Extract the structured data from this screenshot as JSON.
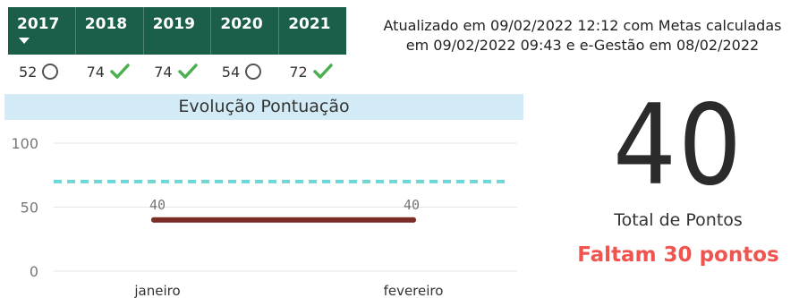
{
  "tabs": [
    "2017",
    "2018",
    "2019",
    "2020",
    "2021"
  ],
  "scores": [
    {
      "value": "52",
      "status": "circle-icon"
    },
    {
      "value": "74",
      "status": "check-icon"
    },
    {
      "value": "74",
      "status": "check-icon"
    },
    {
      "value": "54",
      "status": "circle-icon"
    },
    {
      "value": "72",
      "status": "check-icon"
    }
  ],
  "update_text": {
    "line1": "Atualizado em 09/02/2022 12:12 com Metas calculadas",
    "line2": "em 09/02/2022 09:43 e e-Gestão em 08/02/2022"
  },
  "chart_title": "Evolução Pontuação",
  "kpi": {
    "value": "40",
    "label": "Total de Pontos",
    "remaining": "Faltam 30 pontos"
  },
  "colors": {
    "tab_bg": "#1b5e4a",
    "title_bg": "#d2ebf6",
    "series": "#7b2d26",
    "target": "#6fd6d6",
    "check": "#4caf50",
    "remaining": "#f0544f"
  },
  "chart_data": {
    "type": "line",
    "categories": [
      "janeiro",
      "fevereiro"
    ],
    "series": [
      {
        "values": [
          40,
          40
        ]
      }
    ],
    "data_labels": [
      "40",
      "40"
    ],
    "target_line": 70,
    "y_ticks": [
      "0",
      "50",
      "100"
    ],
    "ylim": [
      0,
      100
    ],
    "grid": true
  }
}
